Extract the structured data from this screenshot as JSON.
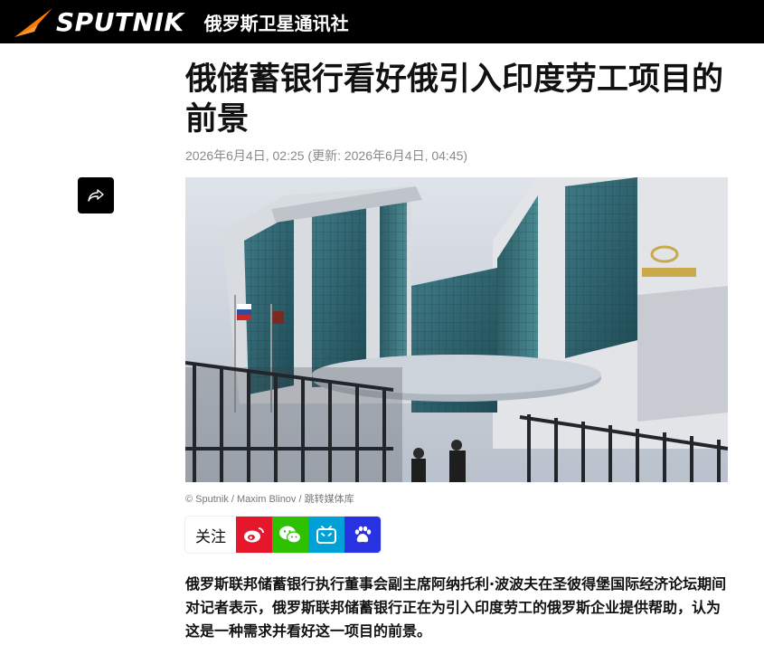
{
  "header": {
    "logo_text": "SPUTNIK",
    "tagline": "俄罗斯卫星通讯社"
  },
  "article": {
    "title": "俄储蓄银行看好俄引入印度劳工项目的前景",
    "meta": "2026年6月4日, 02:25 (更新: 2026年6月4日, 04:45)",
    "photo_credit": "© Sputnik / Maxim Blinov / 跳转媒体库",
    "lead": "俄罗斯联邦储蓄银行执行董事会副主席阿纳托利·波波夫在圣彼得堡国际经济论坛期间对记者表示，俄罗斯联邦储蓄银行正在为引入印度劳工的俄罗斯企业提供帮助，认为这是一种需求并看好这一项目的前景。"
  },
  "share": {
    "icon": "share-icon"
  },
  "social": {
    "follow_label": "关注",
    "buttons": [
      {
        "icon": "weibo-icon",
        "color": "#e6162d"
      },
      {
        "icon": "wechat-icon",
        "color": "#2dc100"
      },
      {
        "icon": "bilibili-icon",
        "color": "#00a1d6"
      },
      {
        "icon": "baidu-icon",
        "color": "#2932e1"
      }
    ]
  },
  "colors": {
    "brand_orange": "#ff7a00",
    "topbar": "#000000"
  }
}
